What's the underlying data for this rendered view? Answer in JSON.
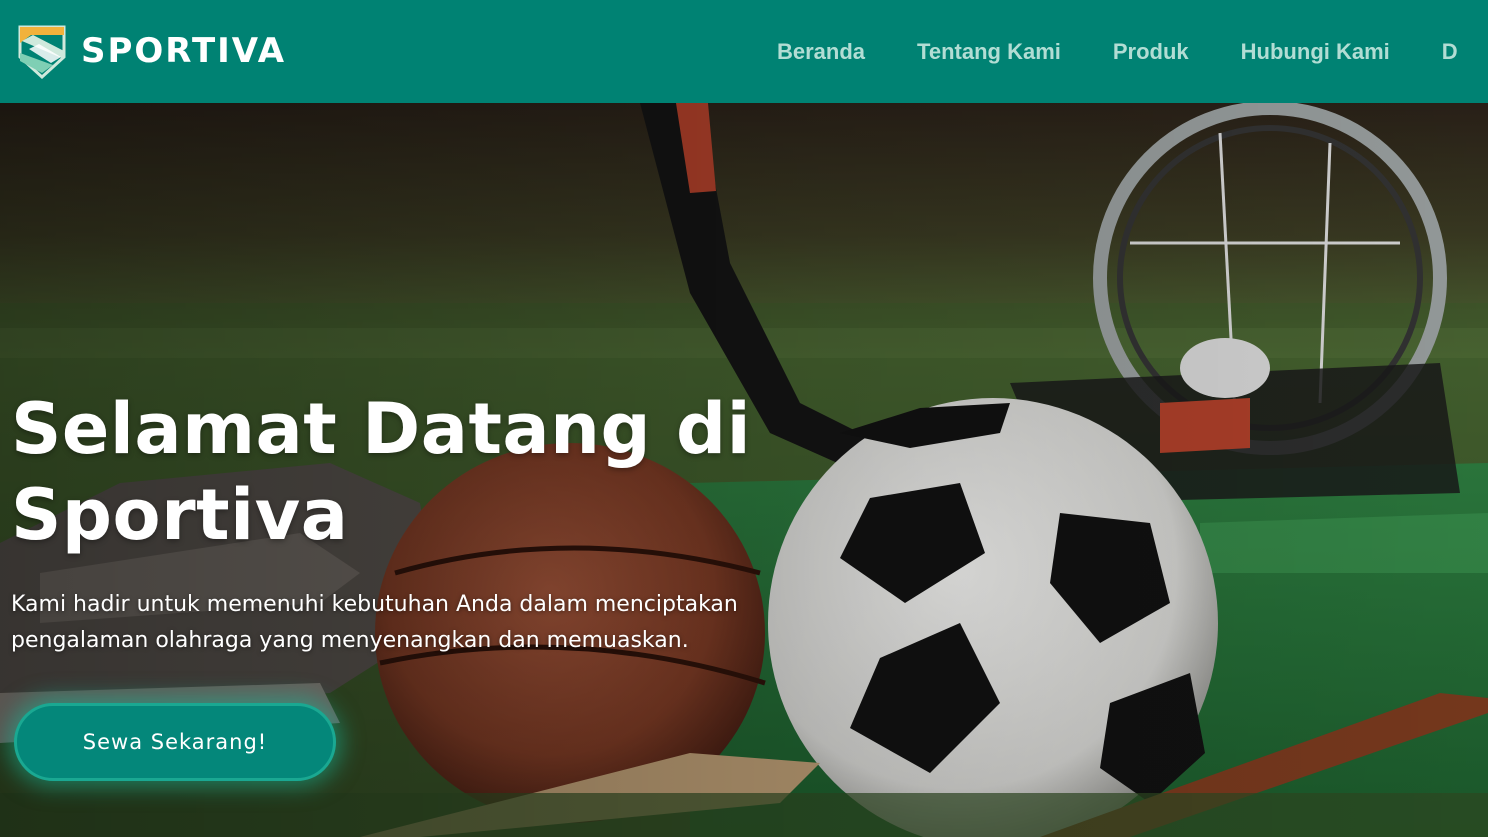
{
  "brand": {
    "name": "SPORTIVA",
    "logo_icon": "shield-s-logo",
    "logo_colors": {
      "gold": "#f2b23c",
      "light": "#cfe9dc",
      "mint": "#7fcfb4"
    }
  },
  "nav": {
    "items": [
      {
        "label": "Beranda"
      },
      {
        "label": "Tentang Kami"
      },
      {
        "label": "Produk"
      },
      {
        "label": "Hubungi Kami"
      },
      {
        "label": "D"
      }
    ]
  },
  "hero": {
    "title": "Selamat Datang di Sportiva",
    "subtitle": "Kami hadir untuk memenuhi kebutuhan Anda dalam menciptakan pengalaman olahraga yang menyenangkan dan memuaskan.",
    "cta_label": "Sewa Sekarang!",
    "background_image": "sports-equipment-on-grass-photo"
  },
  "colors": {
    "navbar_bg": "#008273",
    "nav_link": "#b2ddd4",
    "cta_bg": "#04877a",
    "cta_glow": "#17b496",
    "text_white": "#ffffff"
  }
}
